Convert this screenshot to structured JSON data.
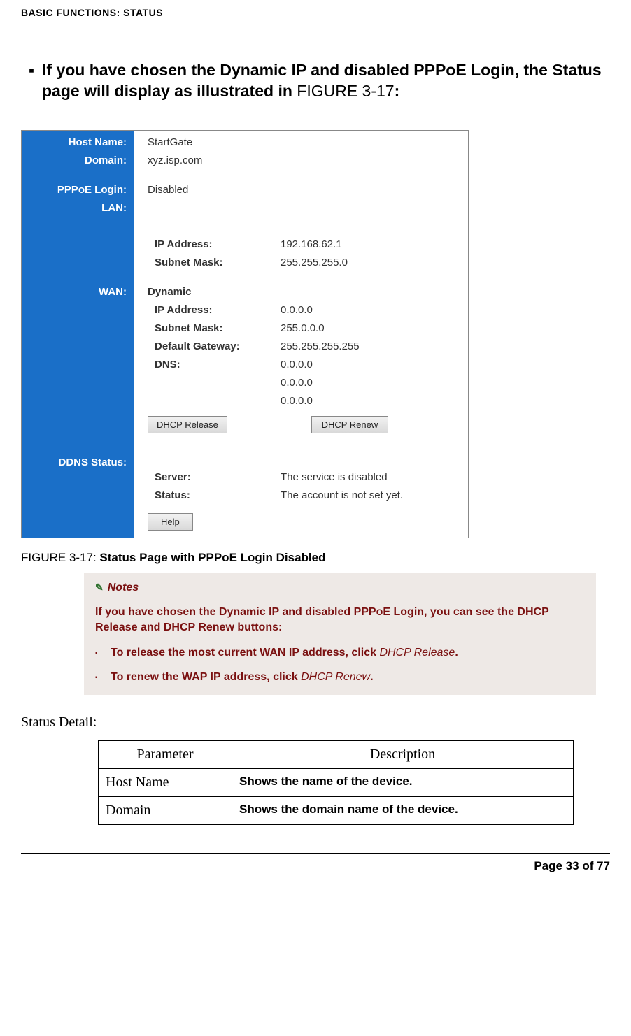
{
  "header": "BASIC FUNCTIONS: STATUS",
  "intro": {
    "prefix": "If you have chosen the Dynamic IP and disabled PPPoE Login, the Status page will display as illustrated in ",
    "figref": "FIGURE 3-17",
    "suffix": ":"
  },
  "screenshot": {
    "sidebar": {
      "host_name": "Host Name:",
      "domain": "Domain:",
      "pppoe": "PPPoE Login:",
      "lan": "LAN:",
      "wan": "WAN:",
      "ddns": "DDNS Status:"
    },
    "content": {
      "host_name_val": "StartGate",
      "domain_val": "xyz.isp.com",
      "pppoe_val": "Disabled",
      "lan_ip_lbl": "IP Address:",
      "lan_ip_val": "192.168.62.1",
      "lan_mask_lbl": "Subnet Mask:",
      "lan_mask_val": "255.255.255.0",
      "wan_mode": "Dynamic",
      "wan_ip_lbl": "IP Address:",
      "wan_ip_val": "0.0.0.0",
      "wan_mask_lbl": "Subnet Mask:",
      "wan_mask_val": "255.0.0.0",
      "wan_gw_lbl": "Default Gateway:",
      "wan_gw_val": "255.255.255.255",
      "wan_dns_lbl": "DNS:",
      "wan_dns1": "0.0.0.0",
      "wan_dns2": "0.0.0.0",
      "wan_dns3": "0.0.0.0",
      "btn_release": "DHCP Release",
      "btn_renew": "DHCP Renew",
      "ddns_server_lbl": "Server:",
      "ddns_server_val": "The service is disabled",
      "ddns_status_lbl": "Status:",
      "ddns_status_val": "The account is not set yet.",
      "help_btn": "Help"
    }
  },
  "figcaption": {
    "label": "FIGURE 3-17: ",
    "title": "Status Page with PPPoE Login Disabled"
  },
  "notes": {
    "title": "Notes",
    "body": "If you have chosen the Dynamic IP and disabled PPPoE Login, you can see the DHCP Release and DHCP Renew buttons:",
    "b1_pre": "To release the most current WAN IP address, click ",
    "b1_em": "DHCP Release",
    "b1_post": ".",
    "b2_pre": "To renew the WAP IP address, click ",
    "b2_em": "DHCP Renew",
    "b2_post": "."
  },
  "status_detail_label": "Status Detail:",
  "table": {
    "h1": "Parameter",
    "h2": "Description",
    "rows": [
      {
        "p": "Host Name",
        "d": "Shows the name of the device."
      },
      {
        "p": "Domain",
        "d": "Shows the domain name of the device."
      }
    ]
  },
  "footer": "Page 33 of 77"
}
